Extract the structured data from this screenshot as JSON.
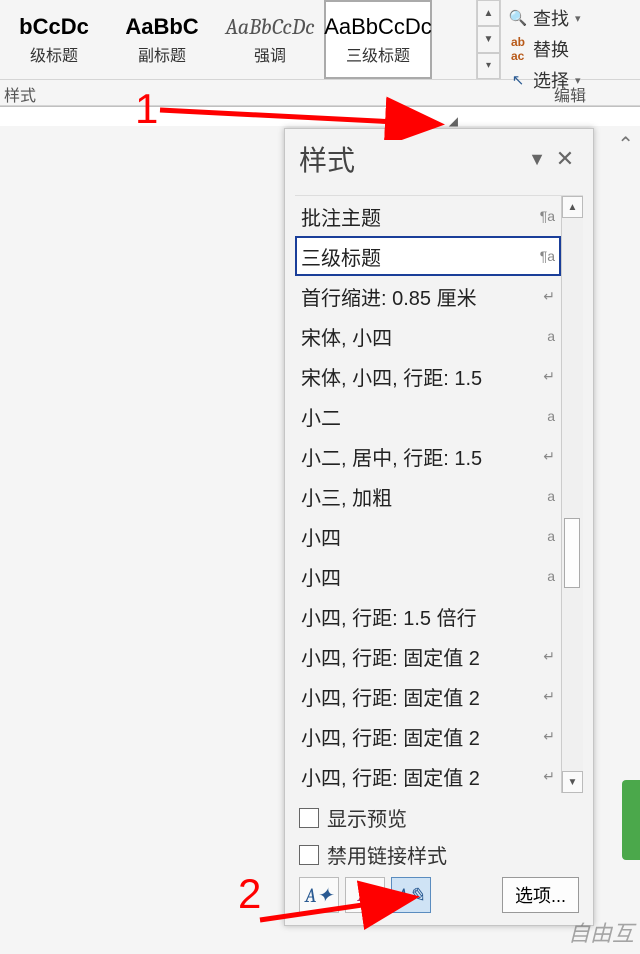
{
  "ribbon": {
    "styles": [
      {
        "preview": "bCcDc",
        "name": "级标题",
        "bold": true
      },
      {
        "preview": "AaBbC",
        "name": "副标题",
        "bold": true
      },
      {
        "preview": "AaBbCcDc",
        "name": "强调",
        "italic": true
      },
      {
        "preview": "AaBbCcDc",
        "name": "三级标题",
        "bold": false,
        "selected": true
      }
    ],
    "section_label": "样式",
    "edit": {
      "find": "查找",
      "replace": "替换",
      "select": "选择",
      "group_label": "编辑"
    }
  },
  "pane": {
    "title": "样式",
    "items": [
      {
        "label": "批注主题",
        "mark": "¶a"
      },
      {
        "label": "三级标题",
        "mark": "¶a",
        "selected": true
      },
      {
        "label": "首行缩进:  0.85 厘米",
        "mark": "↵"
      },
      {
        "label": "宋体, 小四",
        "mark": "a"
      },
      {
        "label": "宋体, 小四, 行距: 1.5",
        "mark": "↵"
      },
      {
        "label": "小二",
        "mark": "a"
      },
      {
        "label": "小二, 居中, 行距: 1.5",
        "mark": "↵"
      },
      {
        "label": "小三, 加粗",
        "mark": "a"
      },
      {
        "label": "小四",
        "mark": "a"
      },
      {
        "label": "小四",
        "mark": "a"
      },
      {
        "label": "小四, 行距: 1.5 倍行",
        "mark": ""
      },
      {
        "label": "小四, 行距: 固定值 2",
        "mark": "↵"
      },
      {
        "label": "小四, 行距: 固定值 2",
        "mark": "↵"
      },
      {
        "label": "小四, 行距: 固定值 2",
        "mark": "↵"
      },
      {
        "label": "小四, 行距: 固定值 2",
        "mark": "↵"
      }
    ],
    "show_preview": "显示预览",
    "disable_linked": "禁用链接样式",
    "options": "选项..."
  },
  "annotations": {
    "one": "1",
    "two": "2"
  },
  "watermark": "自由互"
}
